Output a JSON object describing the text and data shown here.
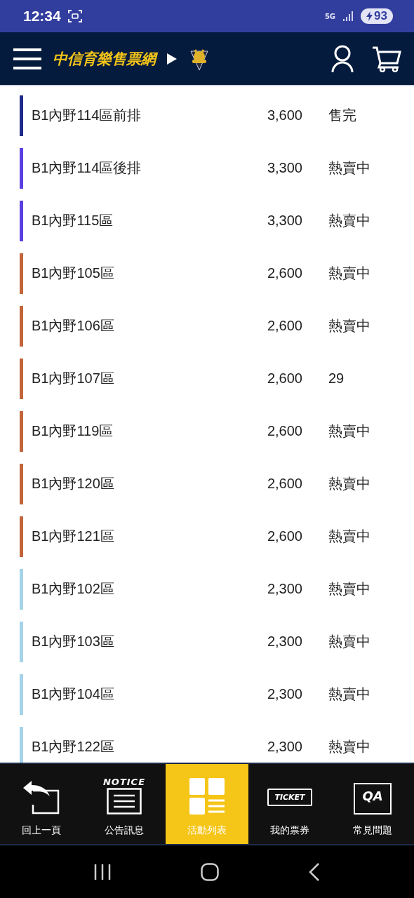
{
  "status_bar": {
    "time": "12:34",
    "network": "5G",
    "battery": "93"
  },
  "header": {
    "title": "中信育樂售票網"
  },
  "seats": [
    {
      "name": "B1內野114區前排",
      "price": "3,600",
      "status": "售完",
      "color": "#1f2a8a"
    },
    {
      "name": "B1內野114區後排",
      "price": "3,300",
      "status": "熱賣中",
      "color": "#5a3fe2"
    },
    {
      "name": "B1內野115區",
      "price": "3,300",
      "status": "熱賣中",
      "color": "#5a3fe2"
    },
    {
      "name": "B1內野105區",
      "price": "2,600",
      "status": "熱賣中",
      "color": "#c2653a"
    },
    {
      "name": "B1內野106區",
      "price": "2,600",
      "status": "熱賣中",
      "color": "#c2653a"
    },
    {
      "name": "B1內野107區",
      "price": "2,600",
      "status": "29",
      "color": "#c2653a"
    },
    {
      "name": "B1內野119區",
      "price": "2,600",
      "status": "熱賣中",
      "color": "#c2653a"
    },
    {
      "name": "B1內野120區",
      "price": "2,600",
      "status": "熱賣中",
      "color": "#c2653a"
    },
    {
      "name": "B1內野121區",
      "price": "2,600",
      "status": "熱賣中",
      "color": "#c2653a"
    },
    {
      "name": "B1內野102區",
      "price": "2,300",
      "status": "熱賣中",
      "color": "#a5d3ea"
    },
    {
      "name": "B1內野103區",
      "price": "2,300",
      "status": "熱賣中",
      "color": "#a5d3ea"
    },
    {
      "name": "B1內野104區",
      "price": "2,300",
      "status": "熱賣中",
      "color": "#a5d3ea"
    },
    {
      "name": "B1內野122區",
      "price": "2,300",
      "status": "熱賣中",
      "color": "#a5d3ea"
    }
  ],
  "bottom_nav": [
    {
      "kind": "back",
      "label": "回上一頁",
      "selected": false
    },
    {
      "kind": "notice",
      "icon_text": "NOTICE",
      "label": "公告訊息",
      "selected": false
    },
    {
      "kind": "events",
      "label": "活動列表",
      "selected": true
    },
    {
      "kind": "ticket",
      "icon_text": "TICKET",
      "label": "我的票券",
      "selected": false
    },
    {
      "kind": "qa",
      "icon_text": "QA",
      "label": "常見問題",
      "selected": false
    }
  ]
}
